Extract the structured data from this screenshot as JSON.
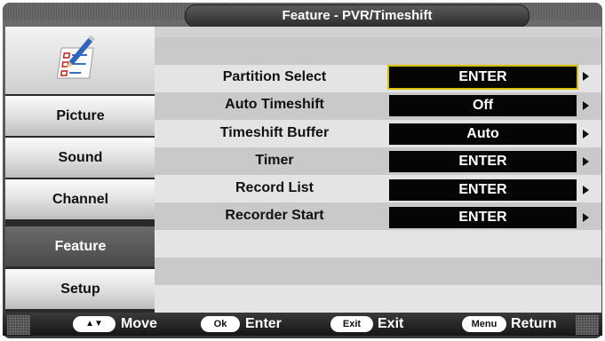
{
  "title": "Feature - PVR/Timeshift",
  "sidebar": {
    "icon": "checklist-pencil-icon",
    "items": [
      {
        "label": "Picture",
        "active": false
      },
      {
        "label": "Sound",
        "active": false
      },
      {
        "label": "Channel",
        "active": false
      },
      {
        "label": "Feature",
        "active": true
      },
      {
        "label": "Setup",
        "active": false
      }
    ]
  },
  "menu": {
    "rows": [
      {
        "label": "Partition Select",
        "value": "ENTER",
        "focused": true
      },
      {
        "label": "Auto Timeshift",
        "value": "Off",
        "focused": false
      },
      {
        "label": "Timeshift Buffer",
        "value": "Auto",
        "focused": false
      },
      {
        "label": "Timer",
        "value": "ENTER",
        "focused": false
      },
      {
        "label": "Record List",
        "value": "ENTER",
        "focused": false
      },
      {
        "label": "Recorder Start",
        "value": "ENTER",
        "focused": false
      }
    ]
  },
  "hints": {
    "move_key": "▲▼",
    "move": "Move",
    "ok_key": "Ok",
    "enter": "Enter",
    "exit_key": "Exit",
    "exit": "Exit",
    "menu_key": "Menu",
    "return": "Return"
  },
  "colors": {
    "focus_border": "#d8c200",
    "active_tab": "#5a5a5a",
    "value_box": "#050505"
  }
}
